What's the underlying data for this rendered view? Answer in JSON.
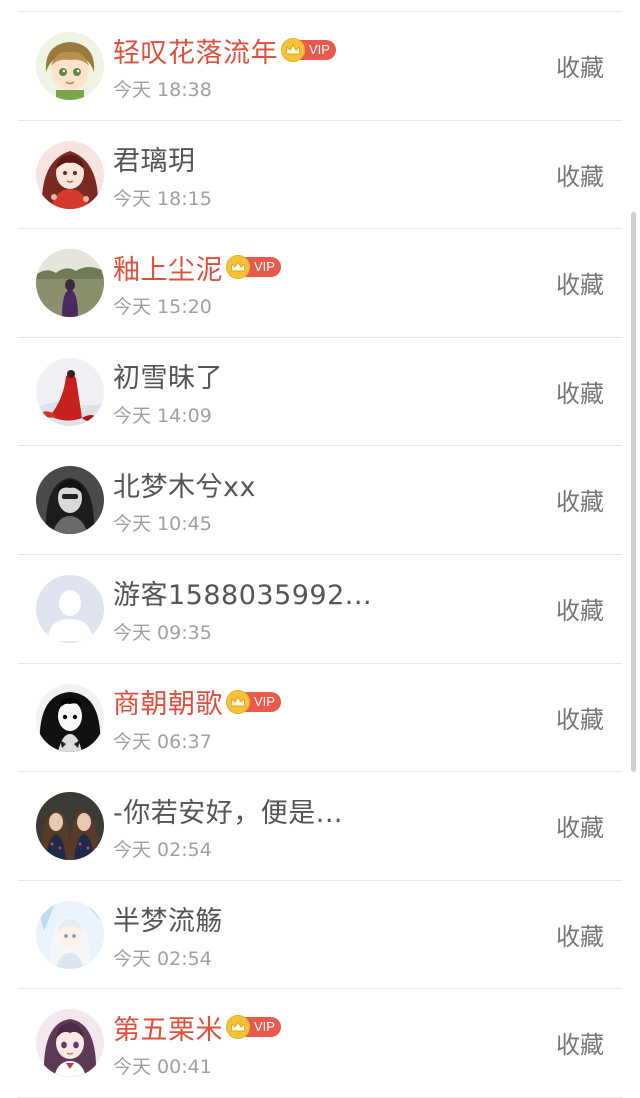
{
  "list": {
    "collect_label": "收藏",
    "vip_label": "VIP",
    "items": [
      {
        "name": "轻叹花落流年",
        "time": "今天 18:38",
        "vip": true,
        "avatar": "cartoon-boy-avatar"
      },
      {
        "name": "君璃玥",
        "time": "今天 18:15",
        "vip": false,
        "avatar": "anime-girl-red-avatar"
      },
      {
        "name": "釉上尘泥",
        "time": "今天 15:20",
        "vip": true,
        "avatar": "road-girl-avatar"
      },
      {
        "name": "初雪昧了",
        "time": "今天 14:09",
        "vip": false,
        "avatar": "red-dress-snow-avatar"
      },
      {
        "name": "北梦木兮xx",
        "time": "今天 10:45",
        "vip": false,
        "avatar": "grayscale-portrait-avatar"
      },
      {
        "name": "游客1588035992...",
        "time": "今天 09:35",
        "vip": false,
        "avatar": "default-user-avatar"
      },
      {
        "name": "商朝朝歌",
        "time": "今天 06:37",
        "vip": true,
        "avatar": "monochrome-girl-avatar"
      },
      {
        "name": "-你若安好，便是...",
        "time": "今天 02:54",
        "vip": false,
        "avatar": "twin-girls-avatar"
      },
      {
        "name": "半梦流觞",
        "time": "今天 02:54",
        "vip": false,
        "avatar": "pale-anime-avatar"
      },
      {
        "name": "第五栗米",
        "time": "今天 00:41",
        "vip": true,
        "avatar": "purple-hair-girl-avatar"
      }
    ]
  },
  "colors": {
    "vip_name": "#e0513d",
    "normal_name": "#555555",
    "time": "#a0a0a0",
    "vip_tag": "#e85a4b",
    "crown": "#f4c33a"
  }
}
